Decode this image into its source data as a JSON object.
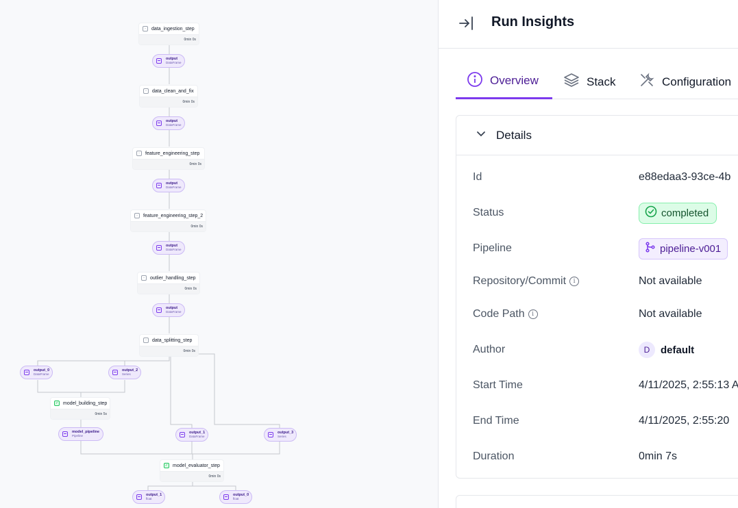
{
  "dag": {
    "steps": [
      {
        "name": "data_ingestion_step",
        "duration": "0min 0s",
        "status": "pending"
      },
      {
        "name": "data_clean_and_fix",
        "duration": "0min 0s",
        "status": "pending"
      },
      {
        "name": "feature_engineering_step",
        "duration": "0min 0s",
        "status": "pending"
      },
      {
        "name": "feature_engineering_step_2",
        "duration": "0min 0s",
        "status": "pending"
      },
      {
        "name": "outlier_handling_step",
        "duration": "0min 0s",
        "status": "pending"
      },
      {
        "name": "data_splitting_step",
        "duration": "0min 0s",
        "status": "pending"
      },
      {
        "name": "model_building_step",
        "duration": "0min 5s",
        "status": "completed"
      },
      {
        "name": "model_evaluator_step",
        "duration": "0min 0s",
        "status": "completed"
      }
    ],
    "artifacts": [
      {
        "name": "output",
        "type": "DataFrame"
      },
      {
        "name": "output",
        "type": "DataFrame"
      },
      {
        "name": "output",
        "type": "DataFrame"
      },
      {
        "name": "output",
        "type": "DataFrame"
      },
      {
        "name": "output",
        "type": "DataFrame"
      },
      {
        "name": "output_0",
        "type": "DataFrame"
      },
      {
        "name": "output_2",
        "type": "Series"
      },
      {
        "name": "model_pipeline",
        "type": "Pipeline"
      },
      {
        "name": "output_1",
        "type": "DataFrame"
      },
      {
        "name": "output_3",
        "type": "Series"
      },
      {
        "name": "output_1",
        "type": "float"
      },
      {
        "name": "output_0",
        "type": "float"
      }
    ]
  },
  "panel": {
    "title": "Run Insights",
    "tabs": [
      {
        "label": "Overview",
        "icon": "info-icon",
        "active": true
      },
      {
        "label": "Stack",
        "icon": "layers-icon",
        "active": false
      },
      {
        "label": "Configuration",
        "icon": "tools-icon",
        "active": false
      }
    ],
    "details": {
      "title": "Details",
      "rows": {
        "id": {
          "key": "Id",
          "value": "e88edaa3-93ce-4b"
        },
        "status": {
          "key": "Status",
          "value": "completed"
        },
        "pipeline": {
          "key": "Pipeline",
          "value": "pipeline-v001"
        },
        "repo": {
          "key": "Repository/Commit",
          "value": "Not available"
        },
        "codepath": {
          "key": "Code Path",
          "value": "Not available"
        },
        "author": {
          "key": "Author",
          "value": "default",
          "initial": "D"
        },
        "start": {
          "key": "Start Time",
          "value": "4/11/2025, 2:55:13 A"
        },
        "end": {
          "key": "End Time",
          "value": "4/11/2025, 2:55:20"
        },
        "duration": {
          "key": "Duration",
          "value": "0min 7s"
        }
      }
    }
  },
  "colors": {
    "accent": "#7c3aed",
    "success": "#16a34a",
    "artifact_bg": "#efe9fc"
  }
}
